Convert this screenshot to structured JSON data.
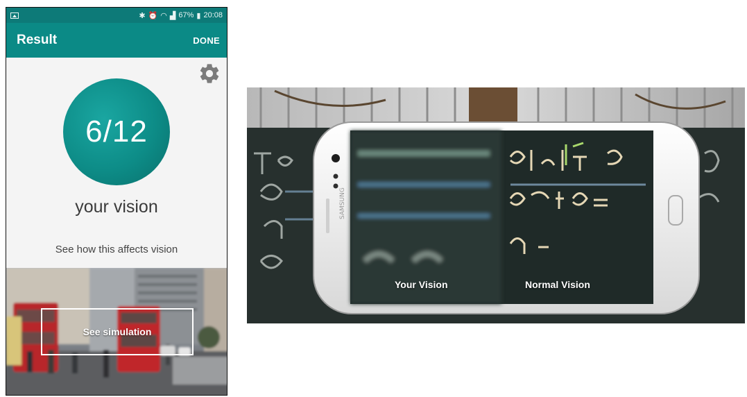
{
  "status_bar": {
    "battery": "67%",
    "time": "20:08",
    "icons": [
      "image-icon",
      "bluetooth-icon",
      "alarm-icon",
      "wifi-icon",
      "signal-icon",
      "battery-icon"
    ]
  },
  "app_bar": {
    "title": "Result",
    "done_label": "DONE"
  },
  "result": {
    "score": "6/12",
    "caption": "your vision",
    "affects_text": "See how this affects vision",
    "simulation_button": "See simulation"
  },
  "comparison_photo": {
    "left_label": "Your Vision",
    "right_label": "Normal Vision",
    "phone_brand": "SAMSUNG"
  },
  "colors": {
    "app_bar": "#0b8a86",
    "status_bar": "#0d7a78",
    "score_circle": "#0d8c87"
  }
}
